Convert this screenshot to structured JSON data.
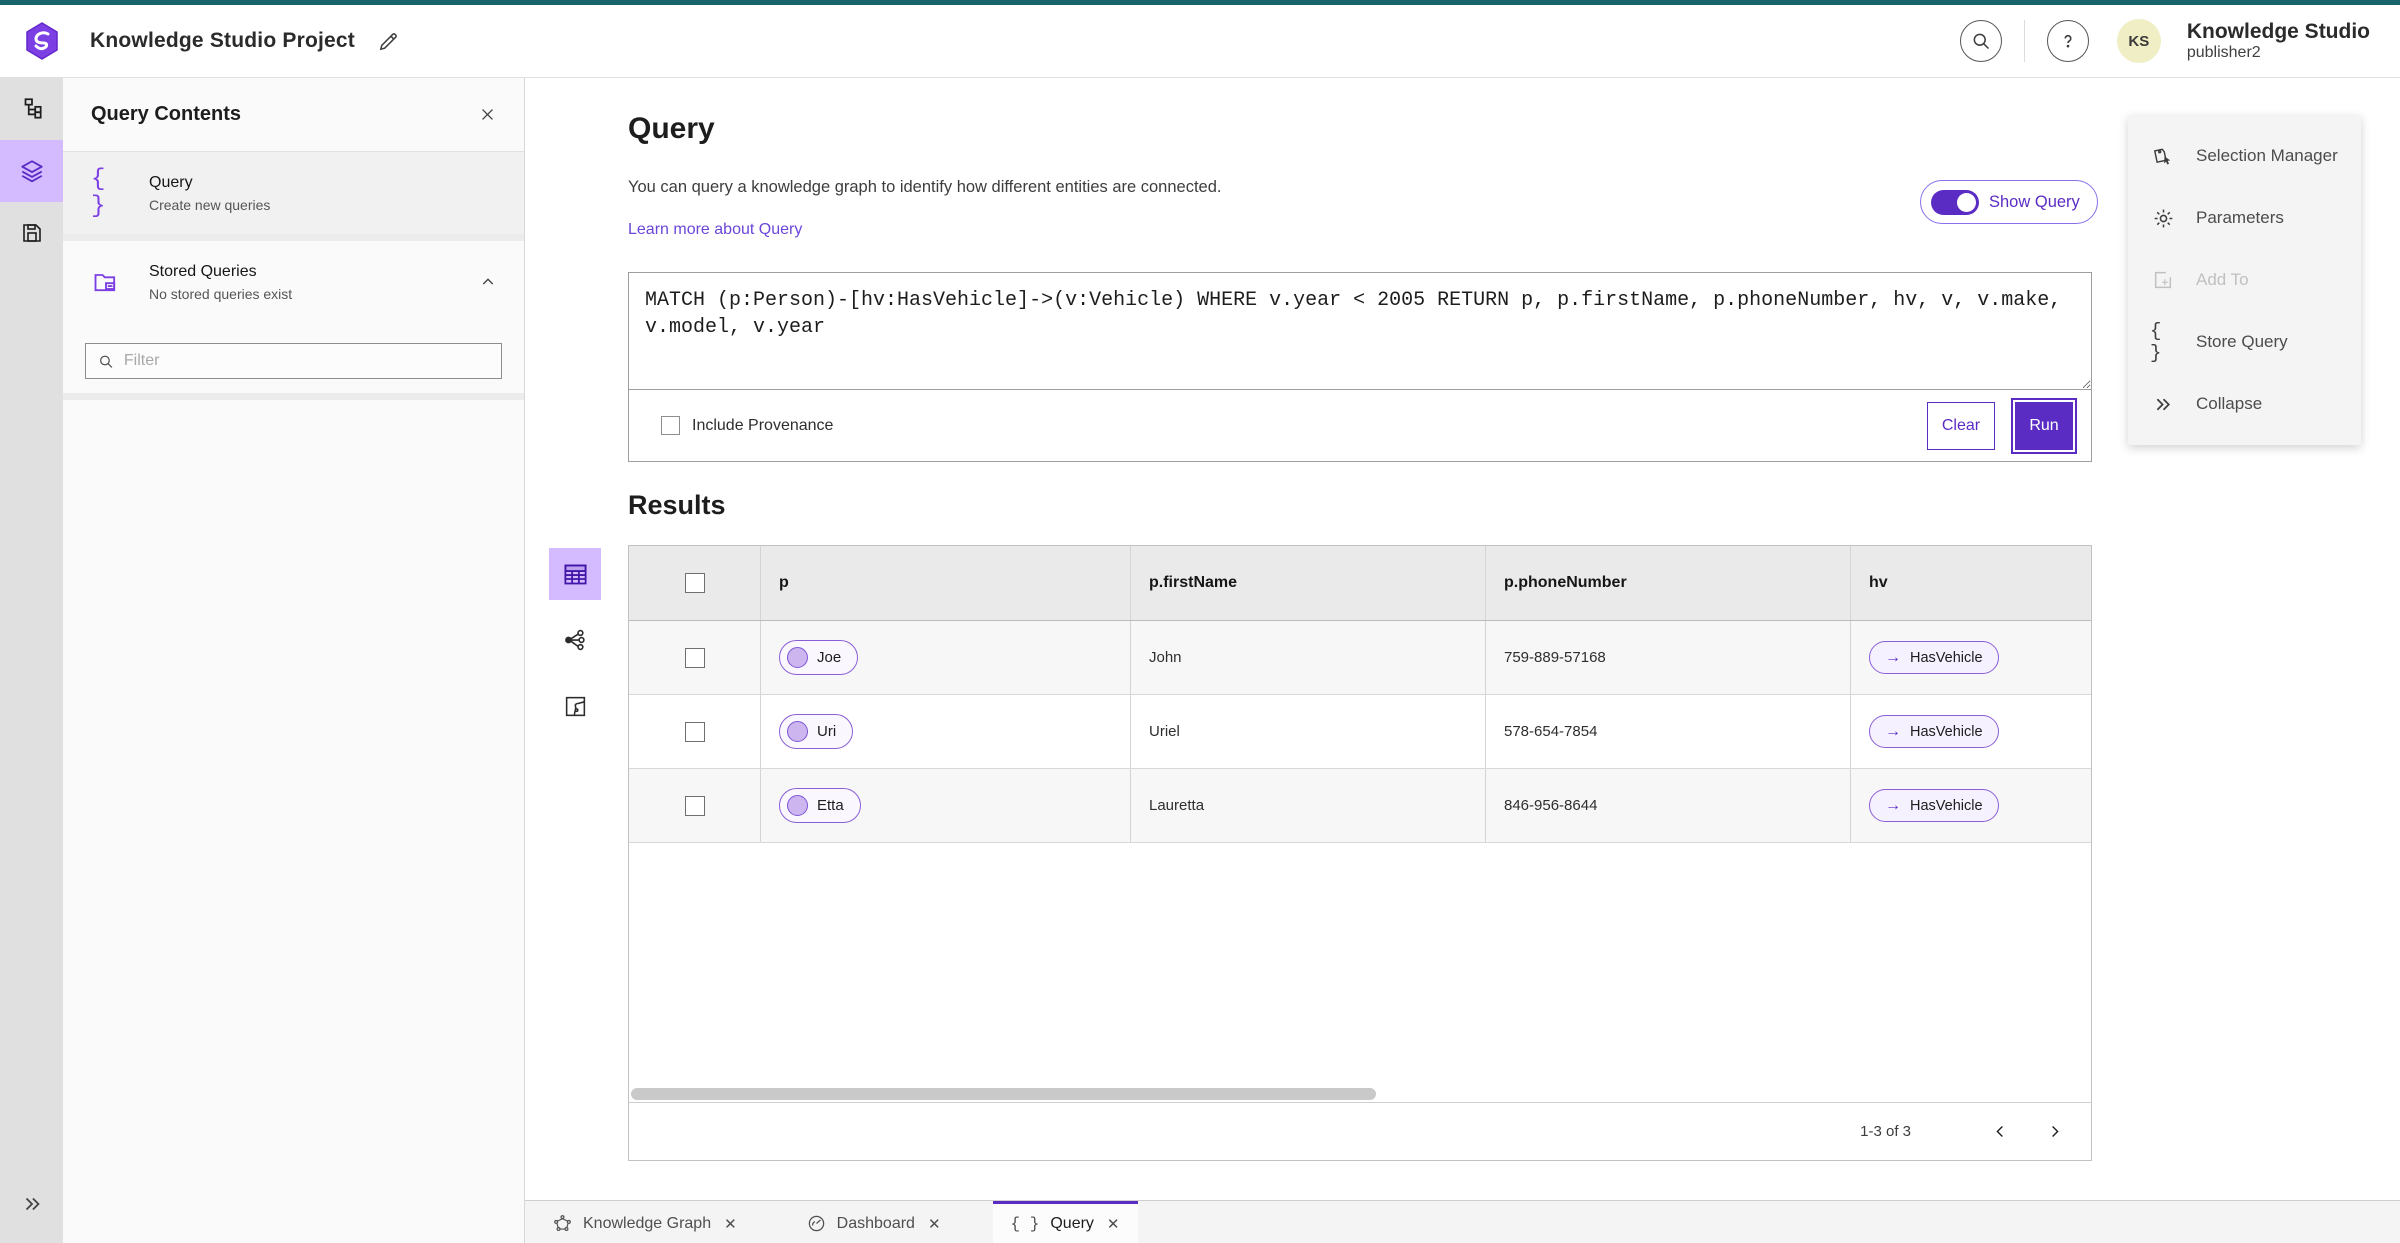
{
  "header": {
    "title": "Knowledge Studio Project",
    "account_name": "Knowledge Studio",
    "account_user": "publisher2",
    "avatar_initials": "KS"
  },
  "panel": {
    "title": "Query Contents",
    "items": [
      {
        "label": "Query",
        "sublabel": "Create new queries"
      },
      {
        "label": "Stored Queries",
        "sublabel": "No stored queries exist"
      }
    ],
    "filter_placeholder": "Filter"
  },
  "query_section": {
    "title": "Query",
    "description": "You can query a knowledge graph to identify how different entities are connected.",
    "learn_more": "Learn more about Query",
    "show_query_label": "Show Query",
    "query_text": "MATCH (p:Person)-[hv:HasVehicle]->(v:Vehicle) WHERE v.year < 2005 RETURN p, p.firstName, p.phoneNumber, hv, v, v.make, v.model, v.year",
    "include_provenance_label": "Include Provenance",
    "clear_label": "Clear",
    "run_label": "Run"
  },
  "results": {
    "title": "Results",
    "columns": [
      "p",
      "p.firstName",
      "p.phoneNumber",
      "hv"
    ],
    "rows": [
      {
        "p": "Joe",
        "firstName": "John",
        "phoneNumber": "759-889-57168",
        "hv": "HasVehicle",
        "hv_arrow": "→"
      },
      {
        "p": "Uri",
        "firstName": "Uriel",
        "phoneNumber": "578-654-7854",
        "hv": "HasVehicle",
        "hv_arrow": "→"
      },
      {
        "p": "Etta",
        "firstName": "Lauretta",
        "phoneNumber": "846-956-8644",
        "hv": "HasVehicle",
        "hv_arrow": "→"
      }
    ],
    "pagination_range": "1-3 of 3"
  },
  "actions_panel": {
    "items": [
      {
        "label": "Selection Manager"
      },
      {
        "label": "Parameters"
      },
      {
        "label": "Add To"
      },
      {
        "label": "Store Query"
      },
      {
        "label": "Collapse"
      }
    ]
  },
  "bottom_tabs": [
    {
      "label": "Knowledge Graph"
    },
    {
      "label": "Dashboard"
    },
    {
      "label": "Query"
    }
  ],
  "glyphs": {
    "braces": "{ }",
    "close": "✕",
    "collapse": "»"
  },
  "colors": {
    "accent": "#5b2cc4",
    "accent_light": "#d4bbff",
    "top_strip_teal": "#17646b",
    "link_purple": "#6b46d9",
    "pill_border": "#8a5fd6",
    "avatar_bg": "#f0eec4"
  }
}
